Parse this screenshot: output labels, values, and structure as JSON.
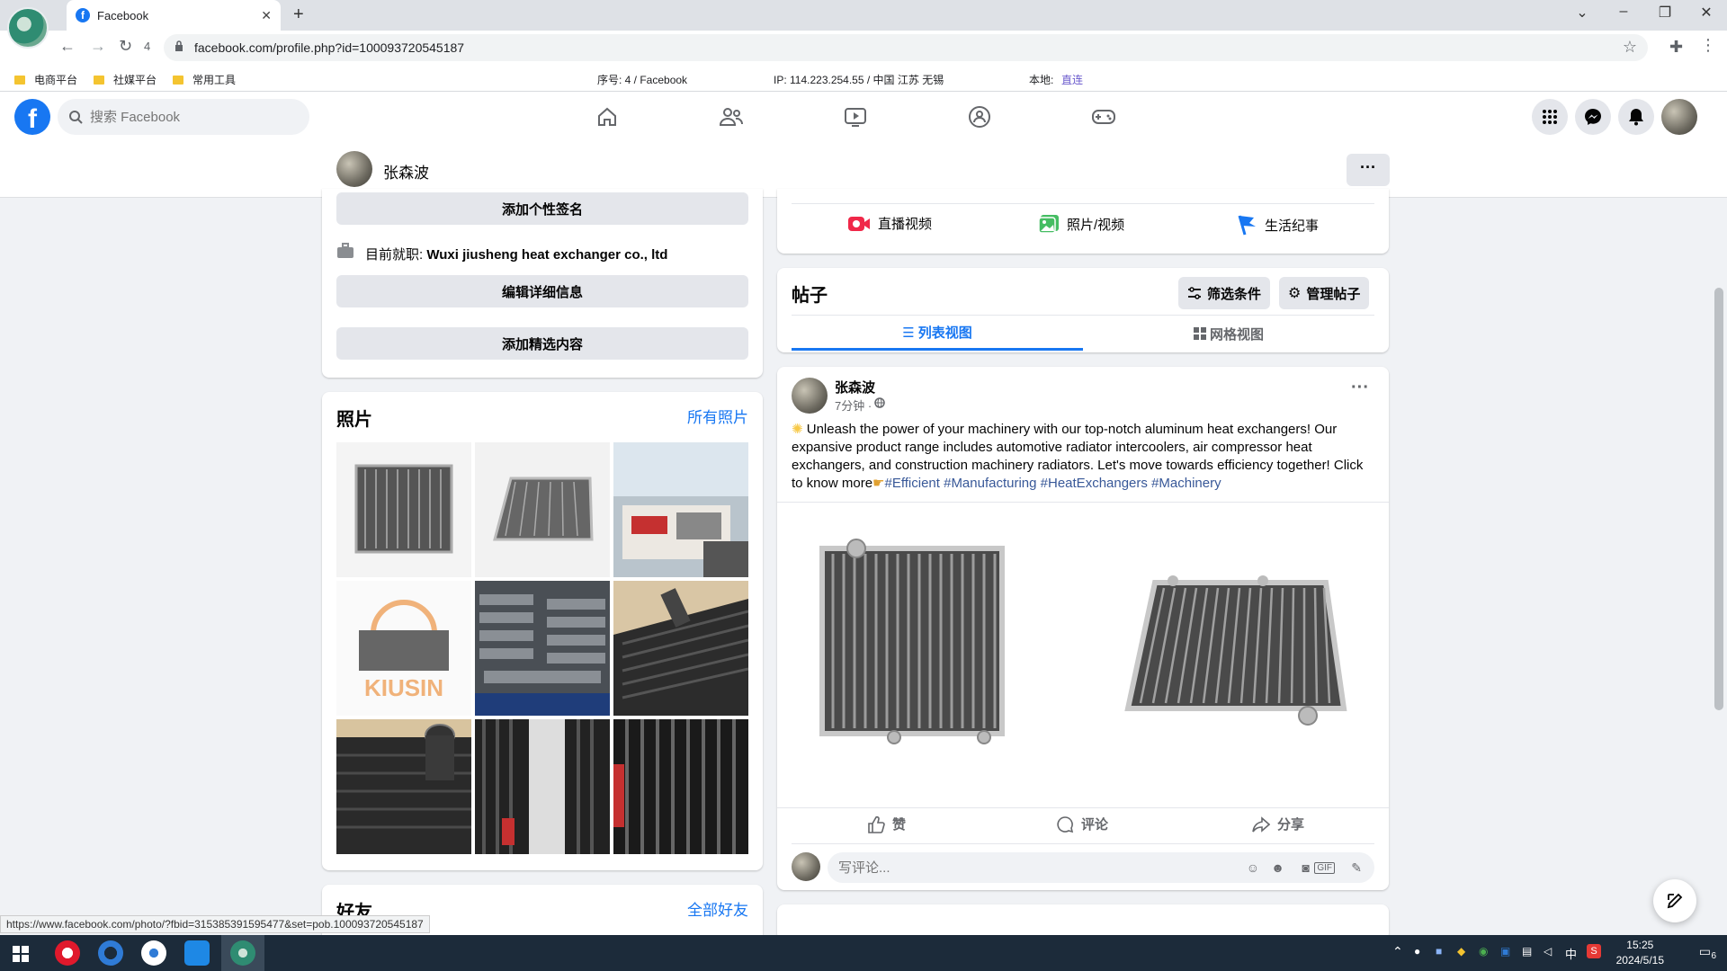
{
  "browser": {
    "tab_title": "Facebook",
    "address": "facebook.com/profile.php?id=100093720545187",
    "reload_count": "4",
    "bookmarks": [
      "电商平台",
      "社媒平台",
      "常用工具"
    ],
    "info_seq": "序号:  4 / Facebook",
    "info_ip": "IP:  114.223.254.55 / 中国 江苏 无锡",
    "info_local_label": "本地:",
    "info_local_value": "直连"
  },
  "fb": {
    "search_placeholder": "搜索 Facebook",
    "profile_name": "张森波",
    "more_label": "···"
  },
  "intro": {
    "add_bio": "添加个性签名",
    "work_prefix": "目前就职:",
    "work_company": "Wuxi jiusheng heat exchanger co., ltd",
    "edit_details": "编辑详细信息",
    "add_featured": "添加精选内容"
  },
  "photos": {
    "title": "照片",
    "all_link": "所有照片"
  },
  "friends": {
    "title": "好友",
    "all_link": "全部好友"
  },
  "composer_actions": {
    "live": "直播视频",
    "photo": "照片/视频",
    "life": "生活纪事"
  },
  "posts_header": {
    "title": "帖子",
    "filter": "筛选条件",
    "manage": "管理帖子",
    "list_view": "列表视图",
    "grid_view": "网格视图"
  },
  "post": {
    "author": "张森波",
    "time": "7分钟 ·",
    "text": "Unleash the power of your machinery with our top-notch aluminum heat exchangers! Our expansive product range includes automotive radiator intercoolers, air compressor heat exchangers, and construction machinery radiators. Let's move towards efficiency together! Click to know more",
    "hashtags": "#Efficient #Manufacturing #HeatExchangers #Machinery",
    "like": "赞",
    "comment": "评论",
    "share": "分享",
    "comment_placeholder": "写评论..."
  },
  "status_url": "https://www.facebook.com/photo/?fbid=315385391595477&set=pob.100093720545187",
  "clock": {
    "time": "15:25",
    "date": "2024/5/15"
  },
  "tray": {
    "lang": "中",
    "notif_count": "6"
  },
  "colors": {
    "fb_blue": "#1877f2",
    "page_bg": "#f0f2f5",
    "taskbar": "#1c2b3a"
  }
}
